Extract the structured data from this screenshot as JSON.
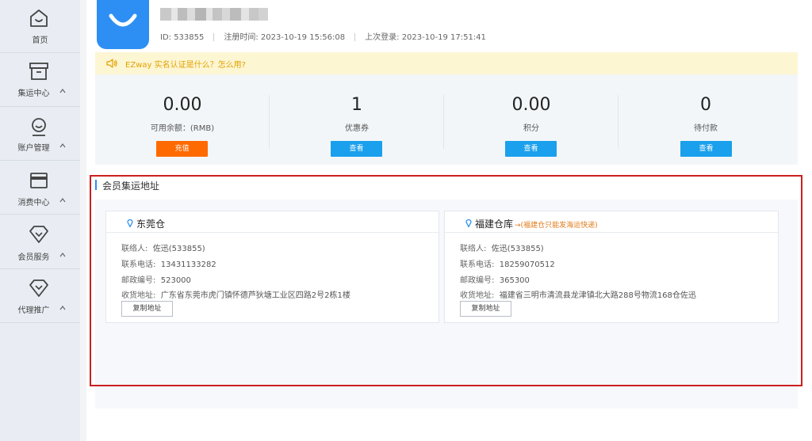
{
  "sidebar": {
    "items": [
      {
        "label": "首页",
        "icon": "home-icon",
        "caret": false
      },
      {
        "label": "集运中心",
        "icon": "box-icon",
        "caret": true
      },
      {
        "label": "账户管理",
        "icon": "user-icon",
        "caret": true
      },
      {
        "label": "消费中心",
        "icon": "card-icon",
        "caret": true
      },
      {
        "label": "会员服务",
        "icon": "diamond-icon",
        "caret": true
      },
      {
        "label": "代理推广",
        "icon": "diamond-heart-icon",
        "caret": true
      }
    ]
  },
  "profile": {
    "id_text": "ID: 533855",
    "register_text": "注册时间: 2023-10-19 15:56:08",
    "last_login_text": "上次登录: 2023-10-19 17:51:41"
  },
  "notice": {
    "text": "EZway 实名认证是什么？怎么用?",
    "icon": "speaker-icon"
  },
  "stats": [
    {
      "value": "0.00",
      "caption": "可用余额：(RMB)",
      "button": "充值",
      "button_color": "#ff6a00"
    },
    {
      "value": "1",
      "caption": "优惠券",
      "button": "查看",
      "button_color": "#1aa0ec"
    },
    {
      "value": "0.00",
      "caption": "积分",
      "button": "查看",
      "button_color": "#1aa0ec"
    },
    {
      "value": "0",
      "caption": "待付款",
      "button": "查看",
      "button_color": "#1aa0ec"
    }
  ],
  "section": {
    "title": "会员集运地址"
  },
  "warehouses": [
    {
      "name": "东莞仓",
      "note": "",
      "contact_key": "联络人:",
      "contact": "佐迅(533855)",
      "phone_key": "联系电话:",
      "phone": "13431133282",
      "zip_key": "邮政编号:",
      "zip": "523000",
      "address_key": "收货地址:",
      "address": "广东省东莞市虎门镇怀德芦狄塘工业区四路2号2栋1楼",
      "copy_label": "复制地址"
    },
    {
      "name": "福建仓库",
      "note": "→(福建仓只能发海运快递)",
      "contact_key": "联络人:",
      "contact": "佐迅(533855)",
      "phone_key": "联系电话:",
      "phone": "18259070512",
      "zip_key": "邮政编号:",
      "zip": "365300",
      "address_key": "收货地址:",
      "address": "福建省三明市清流县龙津镇北大路288号物流168仓佐迅",
      "copy_label": "复制地址"
    }
  ],
  "colors": {
    "accent": "#2d8ff3",
    "recharge": "#ff6a00",
    "view": "#1aa0ec",
    "notice_bg": "#fdf6d3",
    "notice_text": "#e1a100",
    "highlight": "#cc1f1f"
  }
}
